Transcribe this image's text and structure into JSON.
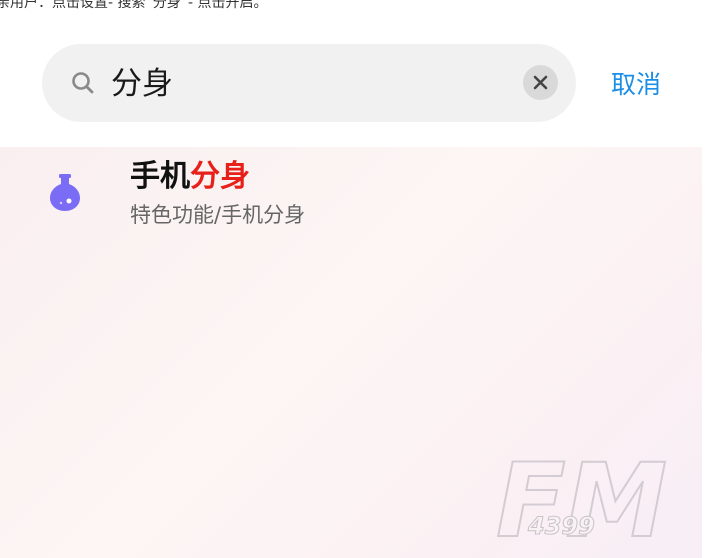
{
  "caption": "亲用户：点击设置- 搜索“分身”- 点击开启。",
  "search": {
    "query": "分身",
    "cancel_label": "取消"
  },
  "results": [
    {
      "title_prefix": "手机",
      "title_highlight": "分身",
      "path": "特色功能/手机分身",
      "icon": "flask-icon"
    }
  ],
  "watermark": {
    "text_main": "FM",
    "text_sub": "4399"
  },
  "colors": {
    "accent": "#1a8ee8",
    "highlight": "#e8201a",
    "icon": "#7b6cf6"
  }
}
